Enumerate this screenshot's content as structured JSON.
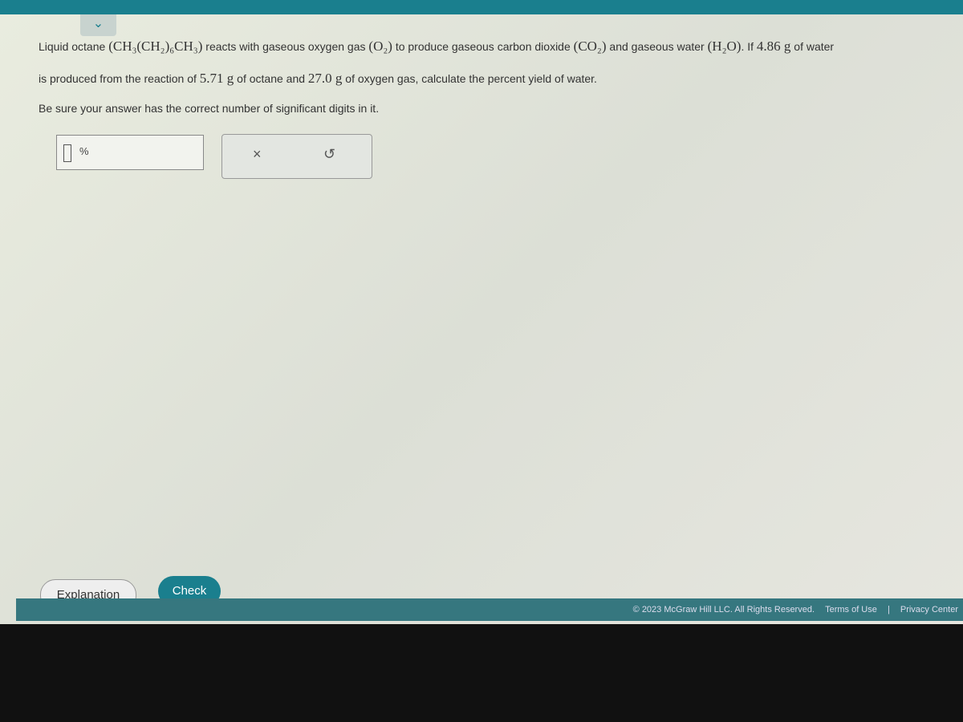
{
  "question": {
    "line1_a": "Liquid octane ",
    "formula_octane": "(CH₃(CH₂)₆CH₃)",
    "line1_b": " reacts with gaseous oxygen gas ",
    "formula_o2": "(O₂)",
    "line1_c": " to produce gaseous carbon dioxide ",
    "formula_co2": "(CO₂)",
    "line1_d": " and gaseous water ",
    "formula_h2o": "(H₂O)",
    "line1_e": ". If ",
    "water_mass": "4.86 g",
    "line1_f": " of water",
    "line2_a": "is produced from the reaction of ",
    "octane_mass": "5.71 g",
    "line2_b": " of octane and ",
    "oxygen_mass": "27.0 g",
    "line2_c": " of oxygen gas, calculate the percent yield of water.",
    "line3": "Be sure your answer has the correct number of significant digits in it."
  },
  "answer": {
    "value": "",
    "unit": "%"
  },
  "tools": {
    "clear": "×",
    "undo": "↺"
  },
  "buttons": {
    "explanation": "Explanation",
    "check": "Check"
  },
  "footer": {
    "copyright": "© 2023 McGraw Hill LLC. All Rights Reserved.",
    "terms": "Terms of Use",
    "sep": "|",
    "privacy": "Privacy Center"
  }
}
